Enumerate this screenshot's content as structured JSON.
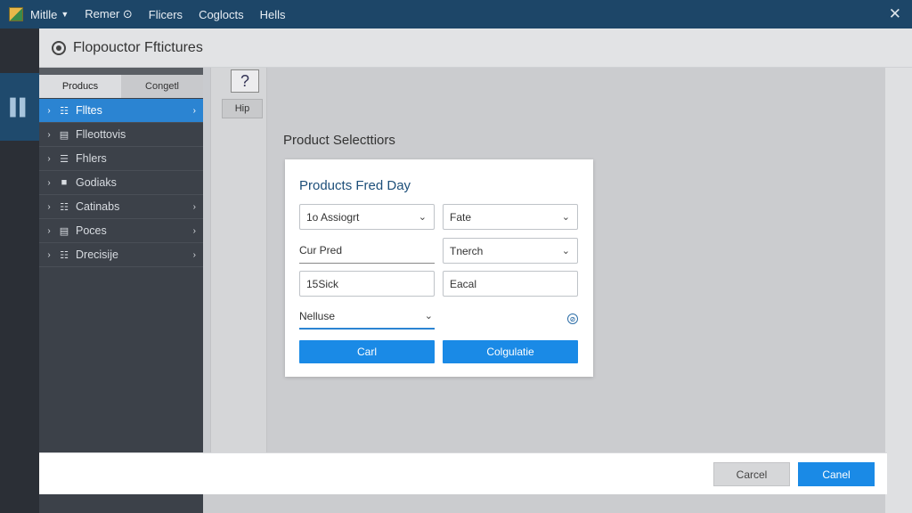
{
  "topbar": {
    "menus": [
      {
        "label": "Mitlle",
        "has_chevron": true
      },
      {
        "label": "Remer ⊙",
        "has_chevron": false
      },
      {
        "label": "Flicers",
        "has_chevron": false
      },
      {
        "label": "Coglocts",
        "has_chevron": false
      },
      {
        "label": "Hells",
        "has_chevron": false
      }
    ],
    "close": "✕"
  },
  "window": {
    "title": "Flopouctor Fftictures"
  },
  "sidebar": {
    "tabs": [
      {
        "label": "Producs",
        "active": true
      },
      {
        "label": "Congetl",
        "active": false
      }
    ],
    "items": [
      {
        "label": "Flltes",
        "icon": "☷",
        "selected": true,
        "has_end_chevron": true
      },
      {
        "label": "Flleottovis",
        "icon": "▤",
        "selected": false,
        "has_end_chevron": false
      },
      {
        "label": "Fhlers",
        "icon": "☰",
        "selected": false,
        "has_end_chevron": false
      },
      {
        "label": "Godiaks",
        "icon": "■",
        "selected": false,
        "has_end_chevron": false
      },
      {
        "label": "Catinabs",
        "icon": "☷",
        "selected": false,
        "has_end_chevron": true
      },
      {
        "label": "Poces",
        "icon": "▤",
        "selected": false,
        "has_end_chevron": true
      },
      {
        "label": "Drecisije",
        "icon": "☷",
        "selected": false,
        "has_end_chevron": true
      }
    ]
  },
  "tools": {
    "help": "?",
    "hip": "Hip"
  },
  "main": {
    "heading": "Product Selecttiors"
  },
  "card": {
    "title": "Products Fred Day",
    "fields": {
      "f1": "1o Assiogrt",
      "f2": "Fate",
      "f3": "Cur Pred",
      "f4": "Tnerch",
      "f5": "15Sick",
      "f6": "Eacal",
      "f7": "Nelluse"
    },
    "info_icon": "⊘",
    "btn_left": "Carl",
    "btn_right": "Colgulatie"
  },
  "bottombar": {
    "cancel": "Carcel",
    "ok": "Canel"
  },
  "colors": {
    "accent": "#1a8ae6",
    "topbar": "#1d4668",
    "sidebar": "#3c4149"
  }
}
